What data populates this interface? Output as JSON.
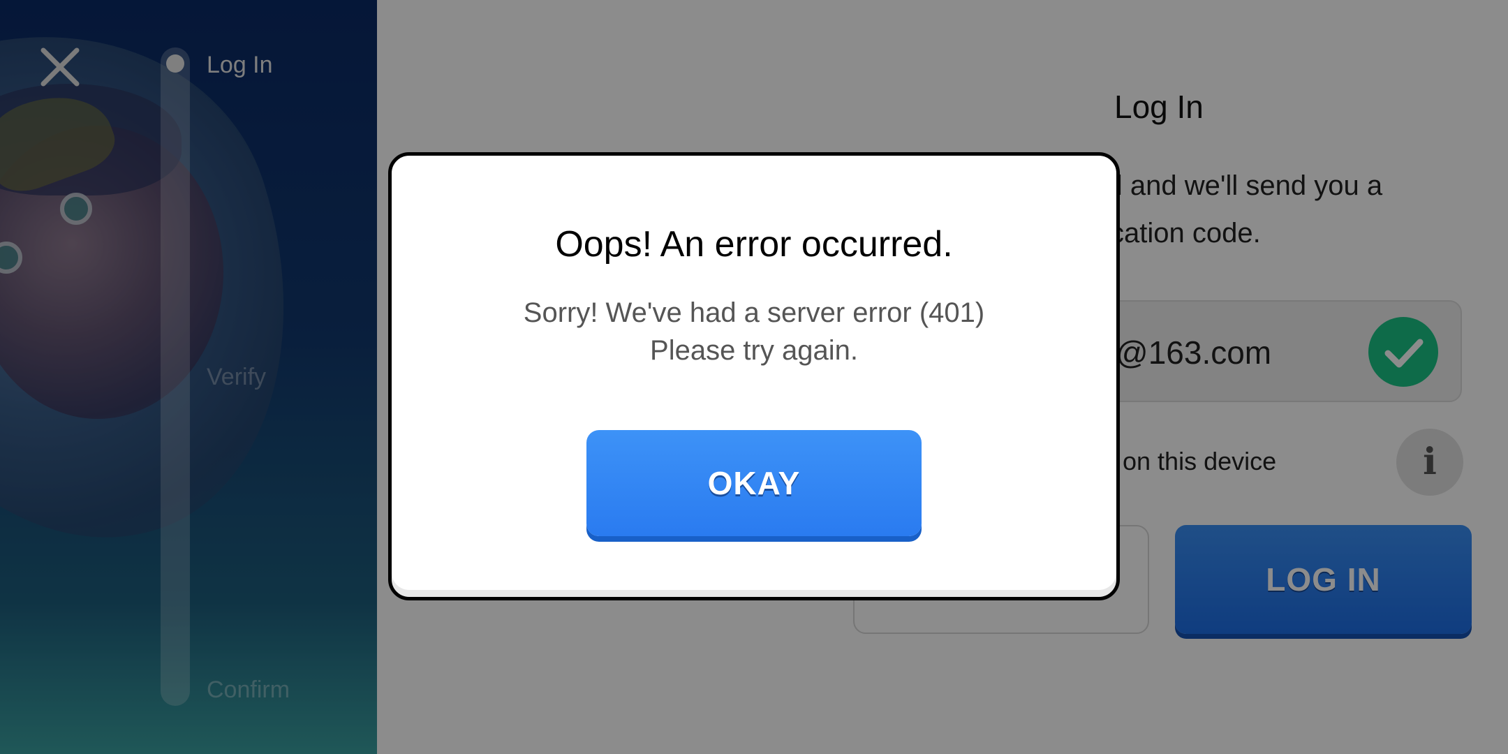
{
  "stepper": {
    "steps": [
      {
        "label": "Log In",
        "active": true
      },
      {
        "label": "Verify",
        "active": false
      },
      {
        "label": "Confirm",
        "active": false
      }
    ]
  },
  "login_form": {
    "title": "Log In",
    "description": "il and we'll send you a\ncation code.",
    "email_value": "@163.com",
    "remember_text": "on this device",
    "login_button_label": "LOG IN"
  },
  "dialog": {
    "title": "Oops! An error occurred.",
    "message": "Sorry! We've had a server error (401)\nPlease try again.",
    "button_label": "OKAY"
  },
  "colors": {
    "primary_button": "#2a7bf0",
    "success": "#1bc486",
    "left_panel": "#0a2a66"
  },
  "icons": [
    "close-icon",
    "checkmark-icon",
    "info-icon"
  ]
}
